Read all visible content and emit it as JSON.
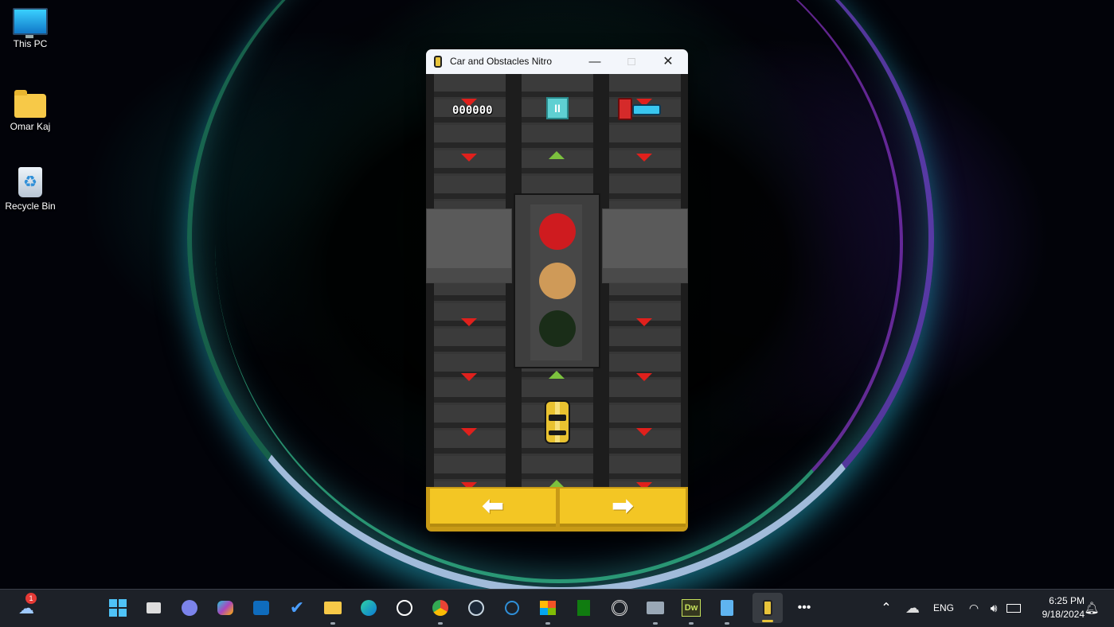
{
  "desktop": {
    "icons": [
      {
        "label": "This PC"
      },
      {
        "label": "Omar Kaj"
      },
      {
        "label": "Recycle Bin"
      }
    ]
  },
  "window": {
    "title": "Car and Obstacles Nitro",
    "minimize_glyph": "—",
    "maximize_glyph": "□",
    "close_glyph": "✕"
  },
  "game": {
    "score": "000000",
    "pause_glyph": "II",
    "traffic_light": {
      "red": "#cf1b1f",
      "amber": "#cf9a58",
      "green": "#1a2d18"
    },
    "left_button_glyph": "⬅",
    "right_button_glyph": "➡",
    "colors": {
      "arrow_down": "#e0201c",
      "arrow_up": "#7cc23e",
      "car": "#e9c230",
      "controls": "#f3c624"
    }
  },
  "taskbar": {
    "weather_badge": "1",
    "apps": [
      "weather",
      "start",
      "task-view",
      "meet",
      "copilot",
      "outlook",
      "todo",
      "file-explorer",
      "edge",
      "whatsapp",
      "chrome",
      "steam",
      "azure-data-studio",
      "microsoft-store",
      "game-bar",
      "vpn",
      "remote-desktop",
      "dreamweaver",
      "notepad",
      "car-and-obstacles-nitro",
      "more"
    ],
    "dreamweaver_label": "Dw",
    "language": "ENG",
    "time": "6:25 PM",
    "date": "9/18/2024"
  }
}
